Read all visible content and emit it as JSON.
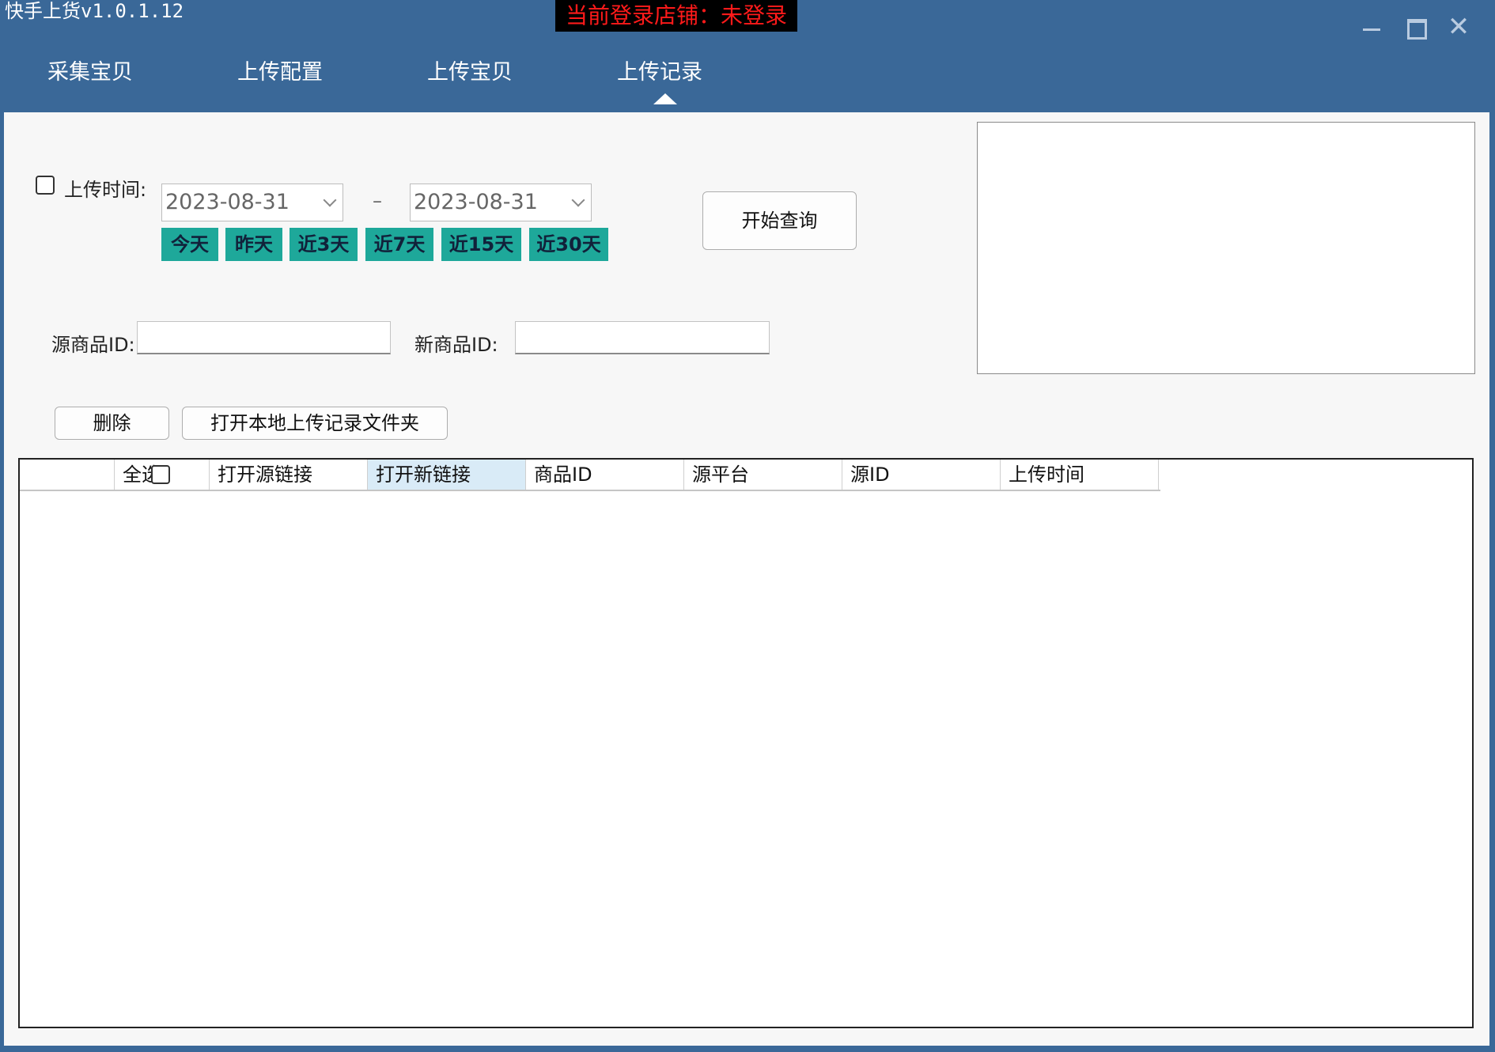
{
  "window": {
    "title": "快手上货v1.0.1.12",
    "login_status": "当前登录店铺：未登录"
  },
  "tabs": [
    {
      "label": "采集宝贝"
    },
    {
      "label": "上传配置"
    },
    {
      "label": "上传宝贝"
    },
    {
      "label": "上传记录"
    }
  ],
  "active_tab": "上传记录",
  "filters": {
    "upload_time_label": "上传时间:",
    "upload_time_checked": false,
    "date_from": "2023-08-31",
    "date_to": "2023-08-31",
    "date_separator": "–",
    "quick_ranges": [
      "今天",
      "昨天",
      "近3天",
      "近7天",
      "近15天",
      "近30天"
    ],
    "query_button": "开始查询",
    "source_id_label": "源商品ID:",
    "source_id_value": "",
    "new_id_label": "新商品ID:",
    "new_id_value": ""
  },
  "actions": {
    "delete_button": "删除",
    "open_folder_button": "打开本地上传记录文件夹"
  },
  "table": {
    "columns": [
      "",
      "全选",
      "打开源链接",
      "打开新链接",
      "商品ID",
      "源平台",
      "源ID",
      "上传时间"
    ],
    "rows": []
  },
  "colors": {
    "frame": "#3a6898",
    "quick_button": "#1ea89a",
    "login_status_text": "#ff1a1a"
  }
}
